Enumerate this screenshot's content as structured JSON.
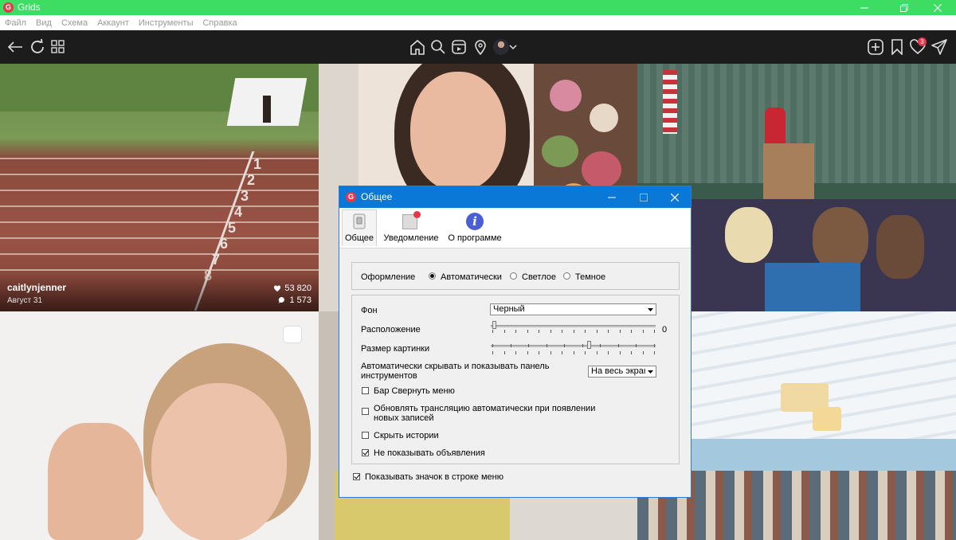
{
  "window": {
    "app_icon_letter": "G",
    "title": "Grids",
    "accent": "#3ddc63"
  },
  "menu": [
    "Файл",
    "Вид",
    "Схема",
    "Аккаунт",
    "Инструменты",
    "Справка"
  ],
  "toolbar": {
    "left_icons": [
      "back-arrow-icon",
      "refresh-icon",
      "grid-icon"
    ],
    "center_icons": [
      "home-icon",
      "search-icon",
      "reels-icon",
      "location-icon",
      "avatar",
      "chevron-down-icon"
    ],
    "right_icons": [
      "add-post-icon",
      "bookmark-icon",
      "heart-icon",
      "send-icon"
    ],
    "notification_count": "3"
  },
  "tiles": {
    "track": {
      "username": "caitlynjenner",
      "date": "Август 31",
      "likes": "53 820",
      "comments": "1 573",
      "lane_numbers": [
        "1",
        "2",
        "3",
        "4",
        "5",
        "6",
        "7",
        "8"
      ]
    }
  },
  "dialog": {
    "icon_letter": "G",
    "title": "Общее",
    "tabs": [
      {
        "label": "Общее",
        "icon": "switch-icon",
        "active": true
      },
      {
        "label": "Уведомление",
        "icon": "notification-icon",
        "active": false
      },
      {
        "label": "О программе",
        "icon": "info-icon",
        "active": false
      }
    ],
    "info_glyph": "i",
    "theme": {
      "label": "Оформление",
      "options": [
        "Автоматически",
        "Светлое",
        "Темное"
      ],
      "selected": "Автоматически"
    },
    "background": {
      "label": "Фон",
      "value": "Черный"
    },
    "position": {
      "label": "Расположение",
      "value_text": "0",
      "level": 0
    },
    "picture_size": {
      "label": "Размер картинки",
      "level": 0.6
    },
    "autohide": {
      "label": "Автоматически скрывать и показывать панель инструментов",
      "value": "На весь экран"
    },
    "checkboxes": [
      {
        "label": "Бар Свернуть меню",
        "checked": false
      },
      {
        "label": "Обновлять трансляцию автоматически при появлении новых записей",
        "checked": false
      },
      {
        "label": "Скрыть истории",
        "checked": false
      },
      {
        "label": "Не показывать объявления",
        "checked": true
      }
    ],
    "tray": {
      "label": "Показывать значок в строке меню",
      "checked": true
    }
  }
}
